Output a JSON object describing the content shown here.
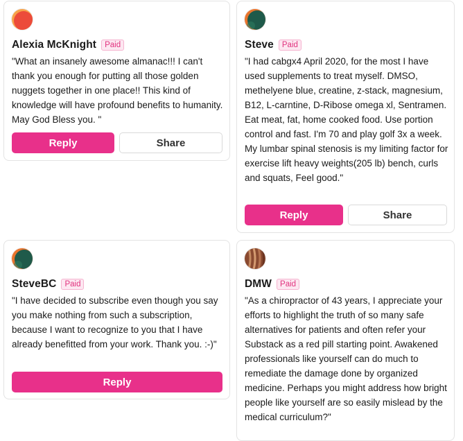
{
  "comments": [
    {
      "name": "Alexia McKnight",
      "badge": "Paid",
      "avatar_colors": [
        "#f7a24a",
        "#ec4b3a"
      ],
      "text": "\"What an insanely awesome almanac!!! I can't thank you enough for putting all those golden nuggets together in one place!! This kind of knowledge will have profound benefits to humanity. May God Bless you. \"",
      "reply_label": "Reply",
      "share_label": "Share"
    },
    {
      "name": "Steve",
      "badge": "Paid",
      "avatar_colors": [
        "#e8742d",
        "#1f5a4a"
      ],
      "text": "\"I had cabgx4 April 2020, for the most I have used supplements to treat myself. DMSO, methelyene blue, creatine, z-stack, magnesium, B12, L-carntine, D-Ribose omega xl, Sentramen. Eat meat, fat, home cooked food. Use portion control and fast. I'm 70 and play golf 3x a week. My lumbar spinal stenosis is my limiting factor for exercise lift heavy weights(205 lb) bench, curls and squats, Feel good.\"",
      "reply_label": "Reply",
      "share_label": "Share"
    },
    {
      "name": "SteveBC",
      "badge": "Paid",
      "avatar_colors": [
        "#e8742d",
        "#1f5a4a"
      ],
      "text": "\"I have decided to subscribe even though you say you make nothing from such a subscription, because I want to recognize to you that I have already benefitted from your work. Thank you. :-)\"",
      "reply_label": "Reply"
    },
    {
      "name": "DMW",
      "badge": "Paid",
      "avatar_colors": [
        "#b06a4a",
        "#6b3420"
      ],
      "text": "\"As a chiropractor of 43 years, I appreciate your efforts to highlight the truth of so many safe alternatives for patients and often refer your Substack as a red pill starting point. Awakened professionals like yourself can do much to remediate the damage done by organized medicine. Perhaps you might address how bright people like yourself are so easily mislead by the medical curriculum?\""
    }
  ]
}
